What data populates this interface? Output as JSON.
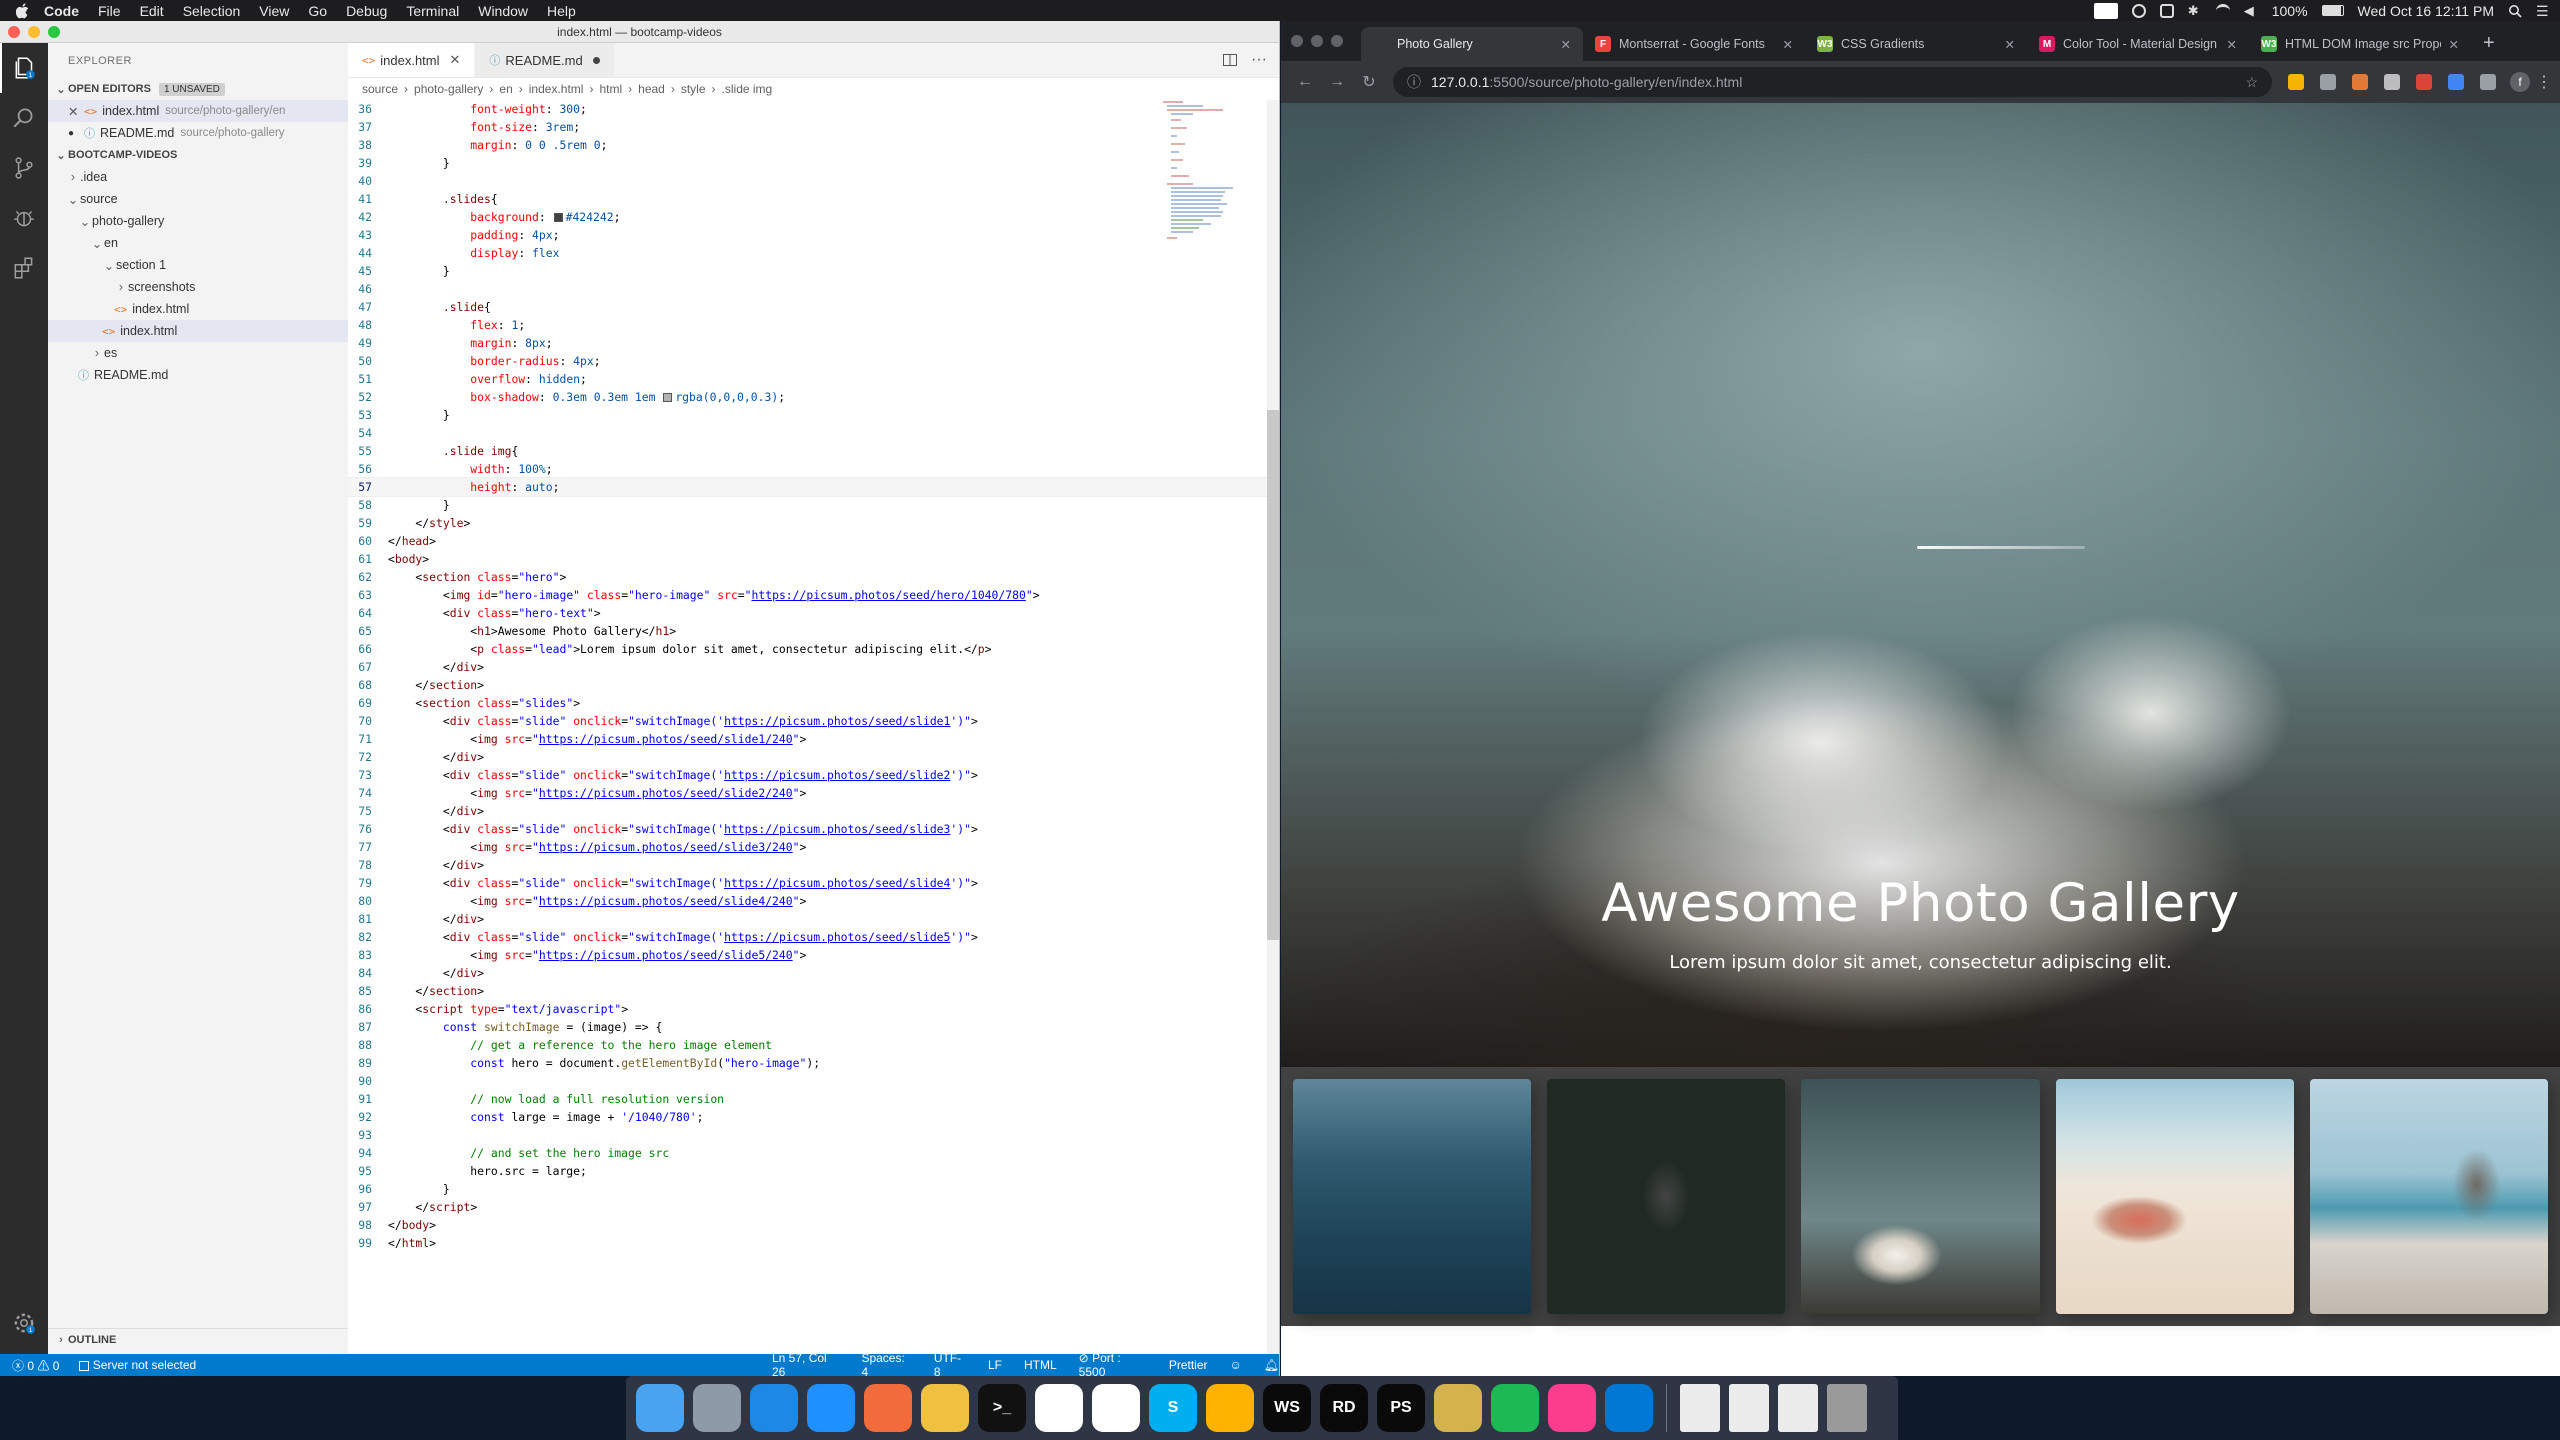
{
  "menubar": {
    "app": "Code",
    "items": [
      "File",
      "Edit",
      "Selection",
      "View",
      "Go",
      "Debug",
      "Terminal",
      "Window",
      "Help"
    ],
    "battery": "100%",
    "clock": "Wed Oct 16  12:11 PM"
  },
  "vscode": {
    "window_title": "index.html — bootcamp-videos",
    "explorer_title": "EXPLORER",
    "open_editors": {
      "label": "OPEN EDITORS",
      "badge": "1 UNSAVED",
      "items": [
        {
          "name": "index.html",
          "path": "source/photo-gallery/en"
        },
        {
          "name": "README.md",
          "path": "source/photo-gallery"
        }
      ]
    },
    "project": "BOOTCAMP-VIDEOS",
    "tree": [
      {
        "label": ".idea",
        "depth": 1,
        "type": "folder"
      },
      {
        "label": "source",
        "depth": 1,
        "type": "folder-open"
      },
      {
        "label": "photo-gallery",
        "depth": 2,
        "type": "folder-open"
      },
      {
        "label": "en",
        "depth": 3,
        "type": "folder-open"
      },
      {
        "label": "section 1",
        "depth": 4,
        "type": "folder-open"
      },
      {
        "label": "screenshots",
        "depth": 5,
        "type": "folder"
      },
      {
        "label": "index.html",
        "depth": 5,
        "type": "html"
      },
      {
        "label": "index.html",
        "depth": 4,
        "type": "html",
        "selected": true
      },
      {
        "label": "es",
        "depth": 3,
        "type": "folder"
      },
      {
        "label": "README.md",
        "depth": 2,
        "type": "info"
      }
    ],
    "outline_label": "OUTLINE",
    "tabs": [
      {
        "label": "index.html"
      },
      {
        "label": "README.md"
      }
    ],
    "breadcrumb": [
      "source",
      "photo-gallery",
      "en",
      "index.html",
      "html",
      "head",
      "style",
      ".slide img"
    ],
    "status": {
      "errors": "0",
      "warnings": "0",
      "server": "Server not selected",
      "position": "Ln 57, Col 26",
      "spaces": "Spaces: 4",
      "encoding": "UTF-8",
      "eol": "LF",
      "language": "HTML",
      "port": "Port : 5500",
      "formatter": "Prettier"
    },
    "code": [
      {
        "n": "36",
        "html": "            <span class='t-prop'>font-weight</span>: <span class='t-val'>300</span>;"
      },
      {
        "n": "37",
        "html": "            <span class='t-prop'>font-size</span>: <span class='t-val'>3rem</span>;"
      },
      {
        "n": "38",
        "html": "            <span class='t-prop'>margin</span>: <span class='t-val'>0 0 .5rem 0</span>;"
      },
      {
        "n": "39",
        "html": "        }"
      },
      {
        "n": "40",
        "html": ""
      },
      {
        "n": "41",
        "html": "        <span class='t-sel'>.slides</span>{"
      },
      {
        "n": "42",
        "html": "            <span class='t-prop'>background</span>: <span class='swatch' style='background:#424242'></span><span class='t-val'>#424242</span>;"
      },
      {
        "n": "43",
        "html": "            <span class='t-prop'>padding</span>: <span class='t-val'>4px</span>;"
      },
      {
        "n": "44",
        "html": "            <span class='t-prop'>display</span>: <span class='t-val'>flex</span>"
      },
      {
        "n": "45",
        "html": "        }"
      },
      {
        "n": "46",
        "html": ""
      },
      {
        "n": "47",
        "html": "        <span class='t-sel'>.slide</span>{"
      },
      {
        "n": "48",
        "html": "            <span class='t-prop'>flex</span>: <span class='t-val'>1</span>;"
      },
      {
        "n": "49",
        "html": "            <span class='t-prop'>margin</span>: <span class='t-val'>8px</span>;"
      },
      {
        "n": "50",
        "html": "            <span class='t-prop'>border-radius</span>: <span class='t-val'>4px</span>;"
      },
      {
        "n": "51",
        "html": "            <span class='t-prop'>overflow</span>: <span class='t-val'>hidden</span>;"
      },
      {
        "n": "52",
        "html": "            <span class='t-prop'>box-shadow</span>: <span class='t-val'>0.3em 0.3em 1em</span> <span class='swatch' style='background:rgba(0,0,0,0.3)'></span><span class='t-val'>rgba(0,0,0,0.3)</span>;"
      },
      {
        "n": "53",
        "html": "        }"
      },
      {
        "n": "54",
        "html": ""
      },
      {
        "n": "55",
        "html": "        <span class='t-sel'>.slide img</span>{"
      },
      {
        "n": "56",
        "html": "            <span class='t-prop'>width</span>: <span class='t-val'>100%</span>;"
      },
      {
        "n": "57",
        "html": "            <span class='t-prop'>height</span>: <span class='t-val'>auto</span>;",
        "cur": true
      },
      {
        "n": "58",
        "html": "        }"
      },
      {
        "n": "59",
        "html": "    &lt;/<span class='t-tag'>style</span>&gt;"
      },
      {
        "n": "60",
        "html": "&lt;/<span class='t-tag'>head</span>&gt;"
      },
      {
        "n": "61",
        "html": "&lt;<span class='t-tag'>body</span>&gt;"
      },
      {
        "n": "62",
        "html": "    &lt;<span class='t-tag'>section</span> <span class='t-attr'>class</span>=<span class='t-str'>\"hero\"</span>&gt;"
      },
      {
        "n": "63",
        "html": "        &lt;<span class='t-tag'>img</span> <span class='t-attr'>id</span>=<span class='t-str'>\"hero-image\"</span> <span class='t-attr'>class</span>=<span class='t-str'>\"hero-image\"</span> <span class='t-attr'>src</span>=<span class='t-str'>\"<span class='t-url'>https://picsum.photos/seed/hero/1040/780</span>\"</span>&gt;"
      },
      {
        "n": "64",
        "html": "        &lt;<span class='t-tag'>div</span> <span class='t-attr'>class</span>=<span class='t-str'>\"hero-text\"</span>&gt;"
      },
      {
        "n": "65",
        "html": "            &lt;<span class='t-tag'>h1</span>&gt;Awesome Photo Gallery&lt;/<span class='t-tag'>h1</span>&gt;"
      },
      {
        "n": "66",
        "html": "            &lt;<span class='t-tag'>p</span> <span class='t-attr'>class</span>=<span class='t-str'>\"lead\"</span>&gt;Lorem ipsum dolor sit amet, consectetur adipiscing elit.&lt;/<span class='t-tag'>p</span>&gt;"
      },
      {
        "n": "67",
        "html": "        &lt;/<span class='t-tag'>div</span>&gt;"
      },
      {
        "n": "68",
        "html": "    &lt;/<span class='t-tag'>section</span>&gt;"
      },
      {
        "n": "69",
        "html": "    &lt;<span class='t-tag'>section</span> <span class='t-attr'>class</span>=<span class='t-str'>\"slides\"</span>&gt;"
      },
      {
        "n": "70",
        "html": "        &lt;<span class='t-tag'>div</span> <span class='t-attr'>class</span>=<span class='t-str'>\"slide\"</span> <span class='t-attr'>onclick</span>=<span class='t-str'>\"switchImage('<span class='t-url'>https://picsum.photos/seed/slide1</span>')\"</span>&gt;"
      },
      {
        "n": "71",
        "html": "            &lt;<span class='t-tag'>img</span> <span class='t-attr'>src</span>=<span class='t-str'>\"<span class='t-url'>https://picsum.photos/seed/slide1/240</span>\"</span>&gt;"
      },
      {
        "n": "72",
        "html": "        &lt;/<span class='t-tag'>div</span>&gt;"
      },
      {
        "n": "73",
        "html": "        &lt;<span class='t-tag'>div</span> <span class='t-attr'>class</span>=<span class='t-str'>\"slide\"</span> <span class='t-attr'>onclick</span>=<span class='t-str'>\"switchImage('<span class='t-url'>https://picsum.photos/seed/slide2</span>')\"</span>&gt;"
      },
      {
        "n": "74",
        "html": "            &lt;<span class='t-tag'>img</span> <span class='t-attr'>src</span>=<span class='t-str'>\"<span class='t-url'>https://picsum.photos/seed/slide2/240</span>\"</span>&gt;"
      },
      {
        "n": "75",
        "html": "        &lt;/<span class='t-tag'>div</span>&gt;"
      },
      {
        "n": "76",
        "html": "        &lt;<span class='t-tag'>div</span> <span class='t-attr'>class</span>=<span class='t-str'>\"slide\"</span> <span class='t-attr'>onclick</span>=<span class='t-str'>\"switchImage('<span class='t-url'>https://picsum.photos/seed/slide3</span>')\"</span>&gt;"
      },
      {
        "n": "77",
        "html": "            &lt;<span class='t-tag'>img</span> <span class='t-attr'>src</span>=<span class='t-str'>\"<span class='t-url'>https://picsum.photos/seed/slide3/240</span>\"</span>&gt;"
      },
      {
        "n": "78",
        "html": "        &lt;/<span class='t-tag'>div</span>&gt;"
      },
      {
        "n": "79",
        "html": "        &lt;<span class='t-tag'>div</span> <span class='t-attr'>class</span>=<span class='t-str'>\"slide\"</span> <span class='t-attr'>onclick</span>=<span class='t-str'>\"switchImage('<span class='t-url'>https://picsum.photos/seed/slide4</span>')\"</span>&gt;"
      },
      {
        "n": "80",
        "html": "            &lt;<span class='t-tag'>img</span> <span class='t-attr'>src</span>=<span class='t-str'>\"<span class='t-url'>https://picsum.photos/seed/slide4/240</span>\"</span>&gt;"
      },
      {
        "n": "81",
        "html": "        &lt;/<span class='t-tag'>div</span>&gt;"
      },
      {
        "n": "82",
        "html": "        &lt;<span class='t-tag'>div</span> <span class='t-attr'>class</span>=<span class='t-str'>\"slide\"</span> <span class='t-attr'>onclick</span>=<span class='t-str'>\"switchImage('<span class='t-url'>https://picsum.photos/seed/slide5</span>')\"</span>&gt;"
      },
      {
        "n": "83",
        "html": "            &lt;<span class='t-tag'>img</span> <span class='t-attr'>src</span>=<span class='t-str'>\"<span class='t-url'>https://picsum.photos/seed/slide5/240</span>\"</span>&gt;"
      },
      {
        "n": "84",
        "html": "        &lt;/<span class='t-tag'>div</span>&gt;"
      },
      {
        "n": "85",
        "html": "    &lt;/<span class='t-tag'>section</span>&gt;"
      },
      {
        "n": "86",
        "html": "    &lt;<span class='t-tag'>script</span> <span class='t-attr'>type</span>=<span class='t-str'>\"text/javascript\"</span>&gt;"
      },
      {
        "n": "87",
        "html": "        <span class='t-kw'>const</span> <span class='t-fn'>switchImage</span> = (image) =&gt; {"
      },
      {
        "n": "88",
        "html": "            <span class='t-com'>// get a reference to the hero image element</span>"
      },
      {
        "n": "89",
        "html": "            <span class='t-kw'>const</span> hero = document.<span class='t-fn'>getElementById</span>(<span class='t-str'>\"hero-image\"</span>);"
      },
      {
        "n": "90",
        "html": ""
      },
      {
        "n": "91",
        "html": "            <span class='t-com'>// now load a full resolution version</span>"
      },
      {
        "n": "92",
        "html": "            <span class='t-kw'>const</span> large = image + <span class='t-str'>'/1040/780'</span>;"
      },
      {
        "n": "93",
        "html": ""
      },
      {
        "n": "94",
        "html": "            <span class='t-com'>// and set the hero image src</span>"
      },
      {
        "n": "95",
        "html": "            hero.src = large;"
      },
      {
        "n": "96",
        "html": "        }"
      },
      {
        "n": "97",
        "html": "    &lt;/<span class='t-tag'>script</span>&gt;"
      },
      {
        "n": "98",
        "html": "&lt;/<span class='t-tag'>body</span>&gt;"
      },
      {
        "n": "99",
        "html": "&lt;/<span class='t-tag'>html</span>&gt;"
      }
    ]
  },
  "chrome": {
    "tabs": [
      {
        "label": "Photo Gallery",
        "color": "#35363a",
        "glyph": "",
        "active": true
      },
      {
        "label": "Montserrat - Google Fonts",
        "color": "#e8453c",
        "glyph": "F"
      },
      {
        "label": "CSS Gradients",
        "color": "#7cb342",
        "glyph": "W3"
      },
      {
        "label": "Color Tool - Material Design",
        "color": "#d81b60",
        "glyph": "M"
      },
      {
        "label": "HTML DOM Image src Property",
        "color": "#4caf50",
        "glyph": "W3"
      }
    ],
    "url_host": "127.0.0.1",
    "url_path": ":5500/source/photo-gallery/en/index.html",
    "extension_icon_colors": [
      "#f4b400",
      "#9aa0a6",
      "#e37933",
      "#bdbdbd",
      "#db4437",
      "#4285f4",
      "#9aa0a6"
    ],
    "profile_initial": "f"
  },
  "page": {
    "title": "Awesome Photo Gallery",
    "lead": "Lorem ipsum dolor sit amet, consectetur adipiscing elit.",
    "slides": [
      {
        "name": "slide-ocean",
        "bg": "linear-gradient(180deg,#5f8699 0%,#2f5a70 35%,#1d4256 70%,#163446 100%)"
      },
      {
        "name": "slide-forest",
        "bg": "radial-gradient(ellipse 40px 60px at 50% 50%, #444 0%, #1f2a22 60%), linear-gradient(135deg,#2e4a2a,#4e6b3f 40%,#1f3320 100%)"
      },
      {
        "name": "slide-cloud",
        "bg": "radial-gradient(ellipse 60px 40px at 40% 75%, #f4f0ea 0%, #d5cfc4 40%, rgba(0,0,0,0) 75%), linear-gradient(180deg,#3d5357,#6f8788 60%,#3c3a35)"
      },
      {
        "name": "slide-beach",
        "bg": "radial-gradient(ellipse 60px 30px at 35% 60%, #d96c5a 0%, #c98f7a 50%, rgba(0,0,0,0) 80%), linear-gradient(180deg,#9fc7d8 0%,#cfe2e6 25%,#efe6da 45%,#e8d7c4 100%)"
      },
      {
        "name": "slide-pelican",
        "bg": "radial-gradient(ellipse 30px 45px at 70% 45%, #6f6a62 0%, rgba(0,0,0,0) 80%), linear-gradient(180deg,#bcd5e2 0%,#9cc4d3 40%,#4c9ab0 55%,#d9d4cc 70%,#bdb7ad 100%)"
      }
    ]
  },
  "dock": {
    "apps": [
      {
        "name": "dock-finder",
        "color": "#4aa3f0",
        "glyph": ""
      },
      {
        "name": "dock-launchpad",
        "color": "#8e9aa8",
        "glyph": ""
      },
      {
        "name": "dock-safari",
        "color": "#1e88e5",
        "glyph": ""
      },
      {
        "name": "dock-app-store",
        "color": "#1e90ff",
        "glyph": ""
      },
      {
        "name": "dock-postman",
        "color": "#f26b3a",
        "glyph": ""
      },
      {
        "name": "dock-sequel",
        "color": "#f0c040",
        "glyph": ""
      },
      {
        "name": "dock-terminal",
        "color": "#111111",
        "glyph": ">_"
      },
      {
        "name": "dock-slack",
        "color": "#ffffff",
        "glyph": ""
      },
      {
        "name": "dock-chrome",
        "color": "#ffffff",
        "glyph": ""
      },
      {
        "name": "dock-skype",
        "color": "#00aff0",
        "glyph": "S"
      },
      {
        "name": "dock-sketch",
        "color": "#fdb300",
        "glyph": ""
      },
      {
        "name": "dock-webstorm",
        "color": "#0a0a0a",
        "glyph": "WS"
      },
      {
        "name": "dock-rider",
        "color": "#0a0a0a",
        "glyph": "RD"
      },
      {
        "name": "dock-phpstorm",
        "color": "#0a0a0a",
        "glyph": "PS"
      },
      {
        "name": "dock-db",
        "color": "#d4b24c",
        "glyph": ""
      },
      {
        "name": "dock-spotify",
        "color": "#1db954",
        "glyph": ""
      },
      {
        "name": "dock-itunes",
        "color": "#fc3c8d",
        "glyph": ""
      },
      {
        "name": "dock-vscode",
        "color": "#0078d4",
        "glyph": ""
      }
    ],
    "docs": [
      {
        "name": "dock-doc-1",
        "color": "#ececec"
      },
      {
        "name": "dock-doc-2",
        "color": "#ececec"
      },
      {
        "name": "dock-doc-3",
        "color": "#ececec"
      },
      {
        "name": "dock-trash",
        "color": "#9a9a9a"
      }
    ]
  }
}
